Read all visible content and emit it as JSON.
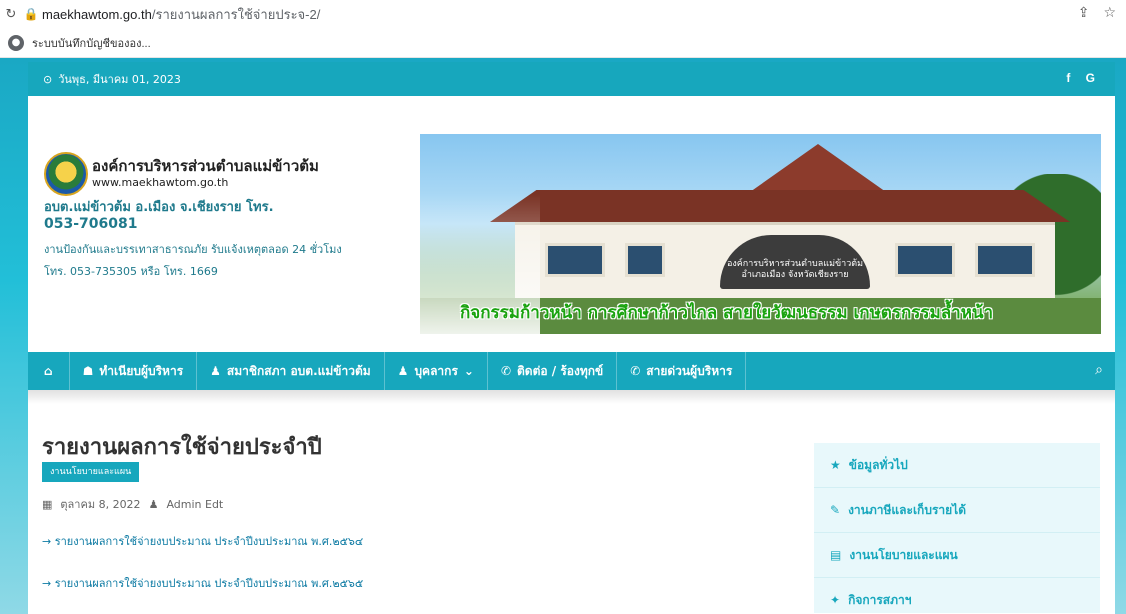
{
  "browser": {
    "url_domain": "maekhawtom.go.th",
    "url_path": "/รายงานผลการใช้จ่ายประจ-2/",
    "bookmark_label": "ระบบบันทึกบัญชีขององ..."
  },
  "topbar": {
    "date": "วันพุธ, มีนาคม 01, 2023",
    "social": "f G"
  },
  "header": {
    "org_name": "องค์การบริหารส่วนตำบลแม่ข้าวต้ม",
    "org_url": "www.maekhawtom.go.th",
    "contact_line": "อบต.แม่ข้าวต้ม อ.เมือง จ.เชียงราย โทร.",
    "contact_phone": "053-706081",
    "emergency": "งานป้องกันและบรรเทาสาธารณภัย รับแจ้งเหตุตลอด 24 ชั่วโมง",
    "emergency_phone": "โทร. 053-735305 หรือ โทร. 1669"
  },
  "banner": {
    "sign_line1": "องค์การบริหารส่วนตำบลแม่ข้าวต้ม",
    "sign_line2": "อำเภอเมือง จังหวัดเชียงราย",
    "slogan": "กิจกรรมก้าวหน้า การศึกษาก้าวไกล สายใยวัฒนธรรม เกษตรกรรมล้ำหน้า"
  },
  "nav": {
    "items": [
      {
        "label": "ทำเนียบผู้บริหาร",
        "icon": "org-chart-icon"
      },
      {
        "label": "สมาชิกสภา อบต.แม่ข้าวต้ม",
        "icon": "users-icon"
      },
      {
        "label": "บุคลากร",
        "icon": "users-icon"
      },
      {
        "label": "ติดต่อ / ร้องทุกข์",
        "icon": "phone-icon"
      },
      {
        "label": "สายด่วนผู้บริหาร",
        "icon": "phone-icon"
      }
    ]
  },
  "post": {
    "title": "รายงานผลการใช้จ่ายประจำปี",
    "category": "งานนโยบายและแผน",
    "date": "ตุลาคม 8, 2022",
    "author": "Admin Edt",
    "links": [
      "→ รายงานผลการใช้จ่ายงบประมาณ ประจำปีงบประมาณ พ.ศ.๒๕๖๔",
      "→ รายงานผลการใช้จ่ายงบประมาณ ประจำปีงบประมาณ พ.ศ.๒๕๖๕"
    ]
  },
  "sidebar": {
    "items": [
      {
        "label": "ข้อมูลทั่วไป",
        "icon": "star-icon"
      },
      {
        "label": "งานภาษีและเก็บรายได้",
        "icon": "edit-icon"
      },
      {
        "label": "งานนโยบายและแผน",
        "icon": "document-icon"
      },
      {
        "label": "กิจการสภาฯ",
        "icon": "pin-icon"
      }
    ]
  },
  "colors": {
    "accent": "#17a7bd",
    "link": "#0c7aa3"
  }
}
